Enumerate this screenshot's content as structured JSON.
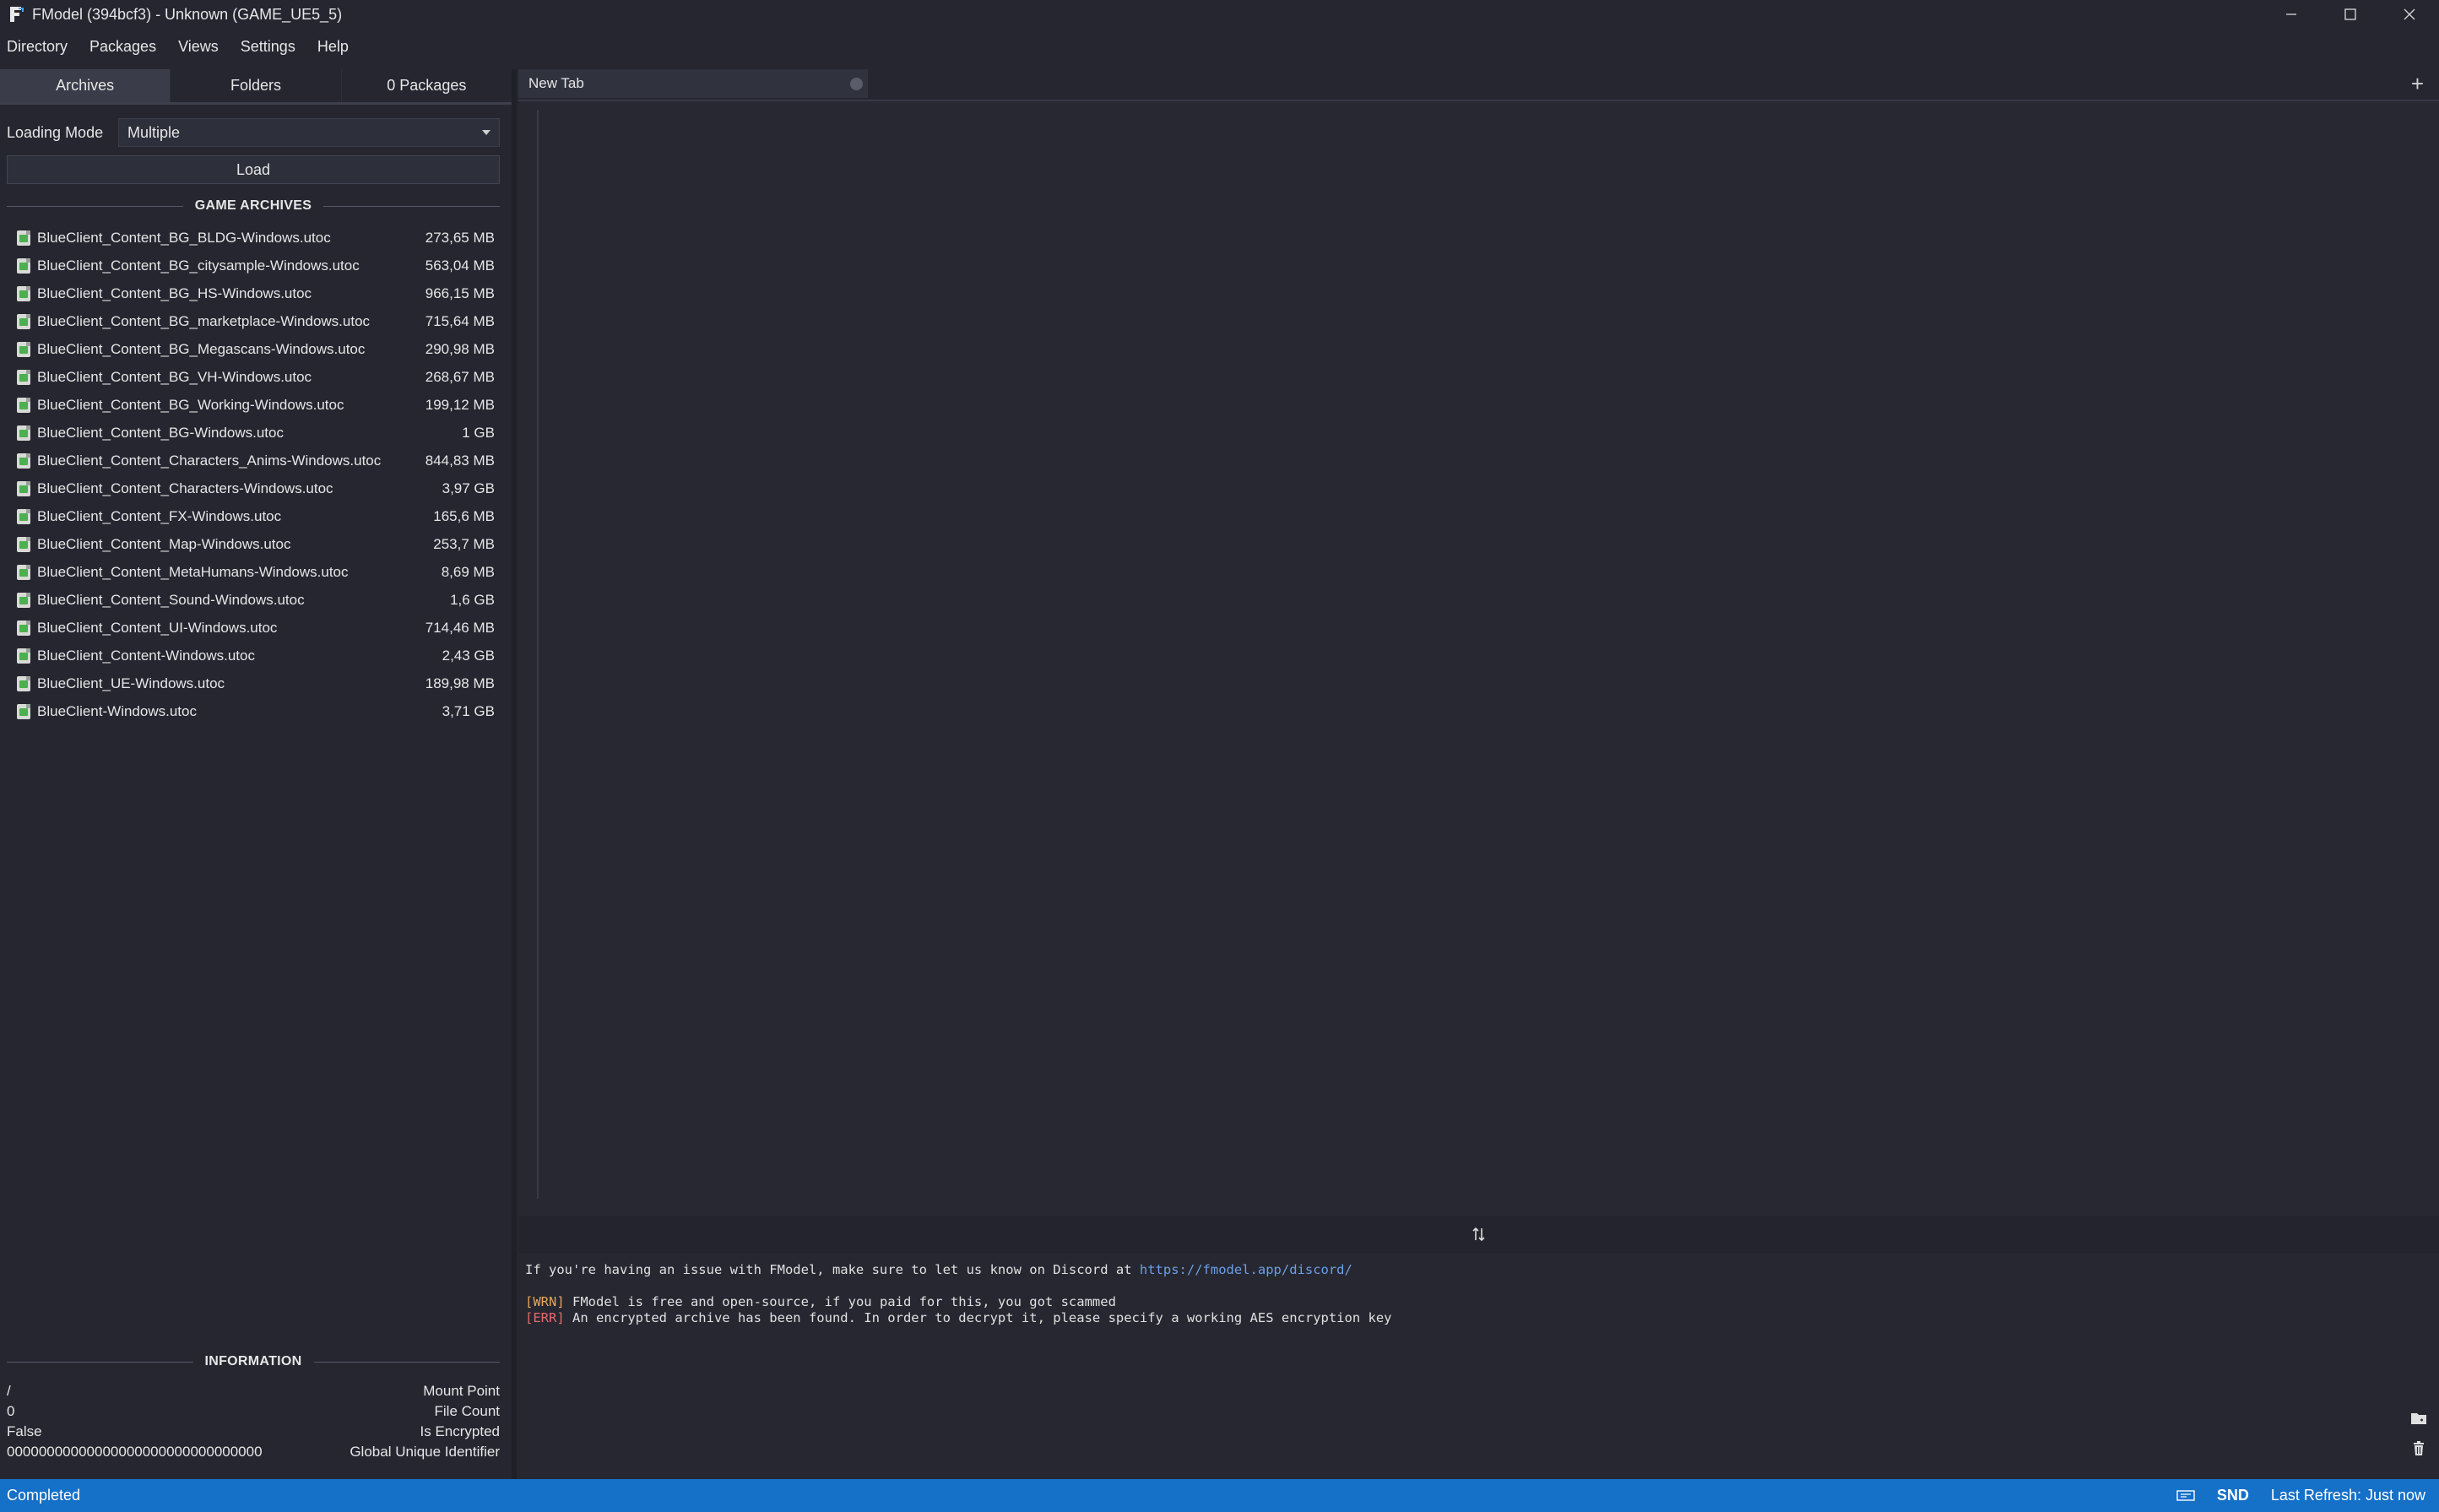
{
  "window": {
    "title": "FModel (394bcf3) - Unknown (GAME_UE5_5)",
    "controls": {
      "minimize": "—",
      "maximize": "☐",
      "close": "✕"
    }
  },
  "menu": [
    "Directory",
    "Packages",
    "Views",
    "Settings",
    "Help"
  ],
  "left_tabs": [
    {
      "label": "Archives",
      "active": true
    },
    {
      "label": "Folders",
      "active": false
    },
    {
      "label": "0 Packages",
      "active": false
    }
  ],
  "loading": {
    "label": "Loading Mode",
    "value": "Multiple"
  },
  "load_button": "Load",
  "game_archives": {
    "title": "GAME ARCHIVES",
    "items": [
      {
        "name": "BlueClient_Content_BG_BLDG-Windows.utoc",
        "size": "273,65 MB"
      },
      {
        "name": "BlueClient_Content_BG_citysample-Windows.utoc",
        "size": "563,04 MB"
      },
      {
        "name": "BlueClient_Content_BG_HS-Windows.utoc",
        "size": "966,15 MB"
      },
      {
        "name": "BlueClient_Content_BG_marketplace-Windows.utoc",
        "size": "715,64 MB"
      },
      {
        "name": "BlueClient_Content_BG_Megascans-Windows.utoc",
        "size": "290,98 MB"
      },
      {
        "name": "BlueClient_Content_BG_VH-Windows.utoc",
        "size": "268,67 MB"
      },
      {
        "name": "BlueClient_Content_BG_Working-Windows.utoc",
        "size": "199,12 MB"
      },
      {
        "name": "BlueClient_Content_BG-Windows.utoc",
        "size": "1 GB"
      },
      {
        "name": "BlueClient_Content_Characters_Anims-Windows.utoc",
        "size": "844,83 MB"
      },
      {
        "name": "BlueClient_Content_Characters-Windows.utoc",
        "size": "3,97 GB"
      },
      {
        "name": "BlueClient_Content_FX-Windows.utoc",
        "size": "165,6 MB"
      },
      {
        "name": "BlueClient_Content_Map-Windows.utoc",
        "size": "253,7 MB"
      },
      {
        "name": "BlueClient_Content_MetaHumans-Windows.utoc",
        "size": "8,69 MB"
      },
      {
        "name": "BlueClient_Content_Sound-Windows.utoc",
        "size": "1,6 GB"
      },
      {
        "name": "BlueClient_Content_UI-Windows.utoc",
        "size": "714,46 MB"
      },
      {
        "name": "BlueClient_Content-Windows.utoc",
        "size": "2,43 GB"
      },
      {
        "name": "BlueClient_UE-Windows.utoc",
        "size": "189,98 MB"
      },
      {
        "name": "BlueClient-Windows.utoc",
        "size": "3,71 GB"
      }
    ]
  },
  "information": {
    "title": "INFORMATION",
    "rows": [
      {
        "value": "/",
        "label": "Mount Point"
      },
      {
        "value": "0",
        "label": "File Count"
      },
      {
        "value": "False",
        "label": "Is Encrypted"
      },
      {
        "value": "00000000000000000000000000000000",
        "label": "Global Unique Identifier"
      }
    ]
  },
  "doc_tab": {
    "label": "New Tab",
    "add": "+"
  },
  "console": {
    "line1_prefix": "If you're having an issue with FModel, make sure to let us know on Discord at ",
    "line1_link": "https://fmodel.app/discord/",
    "warn_tag": "[WRN]",
    "warn_text": " FModel is free and open-source, if you paid for this, you got scammed",
    "err_tag": "[ERR]",
    "err_text": " An encrypted archive has been found. In order to decrypt it, please specify a working AES encryption key"
  },
  "status": {
    "left": "Completed",
    "snd": "SND",
    "last_refresh": "Last Refresh: Just now"
  },
  "colors": {
    "background": "#252630",
    "status_bar": "#1570c8",
    "link": "#6e9ee6",
    "warn": "#e6a55a",
    "err": "#e66a6a"
  }
}
